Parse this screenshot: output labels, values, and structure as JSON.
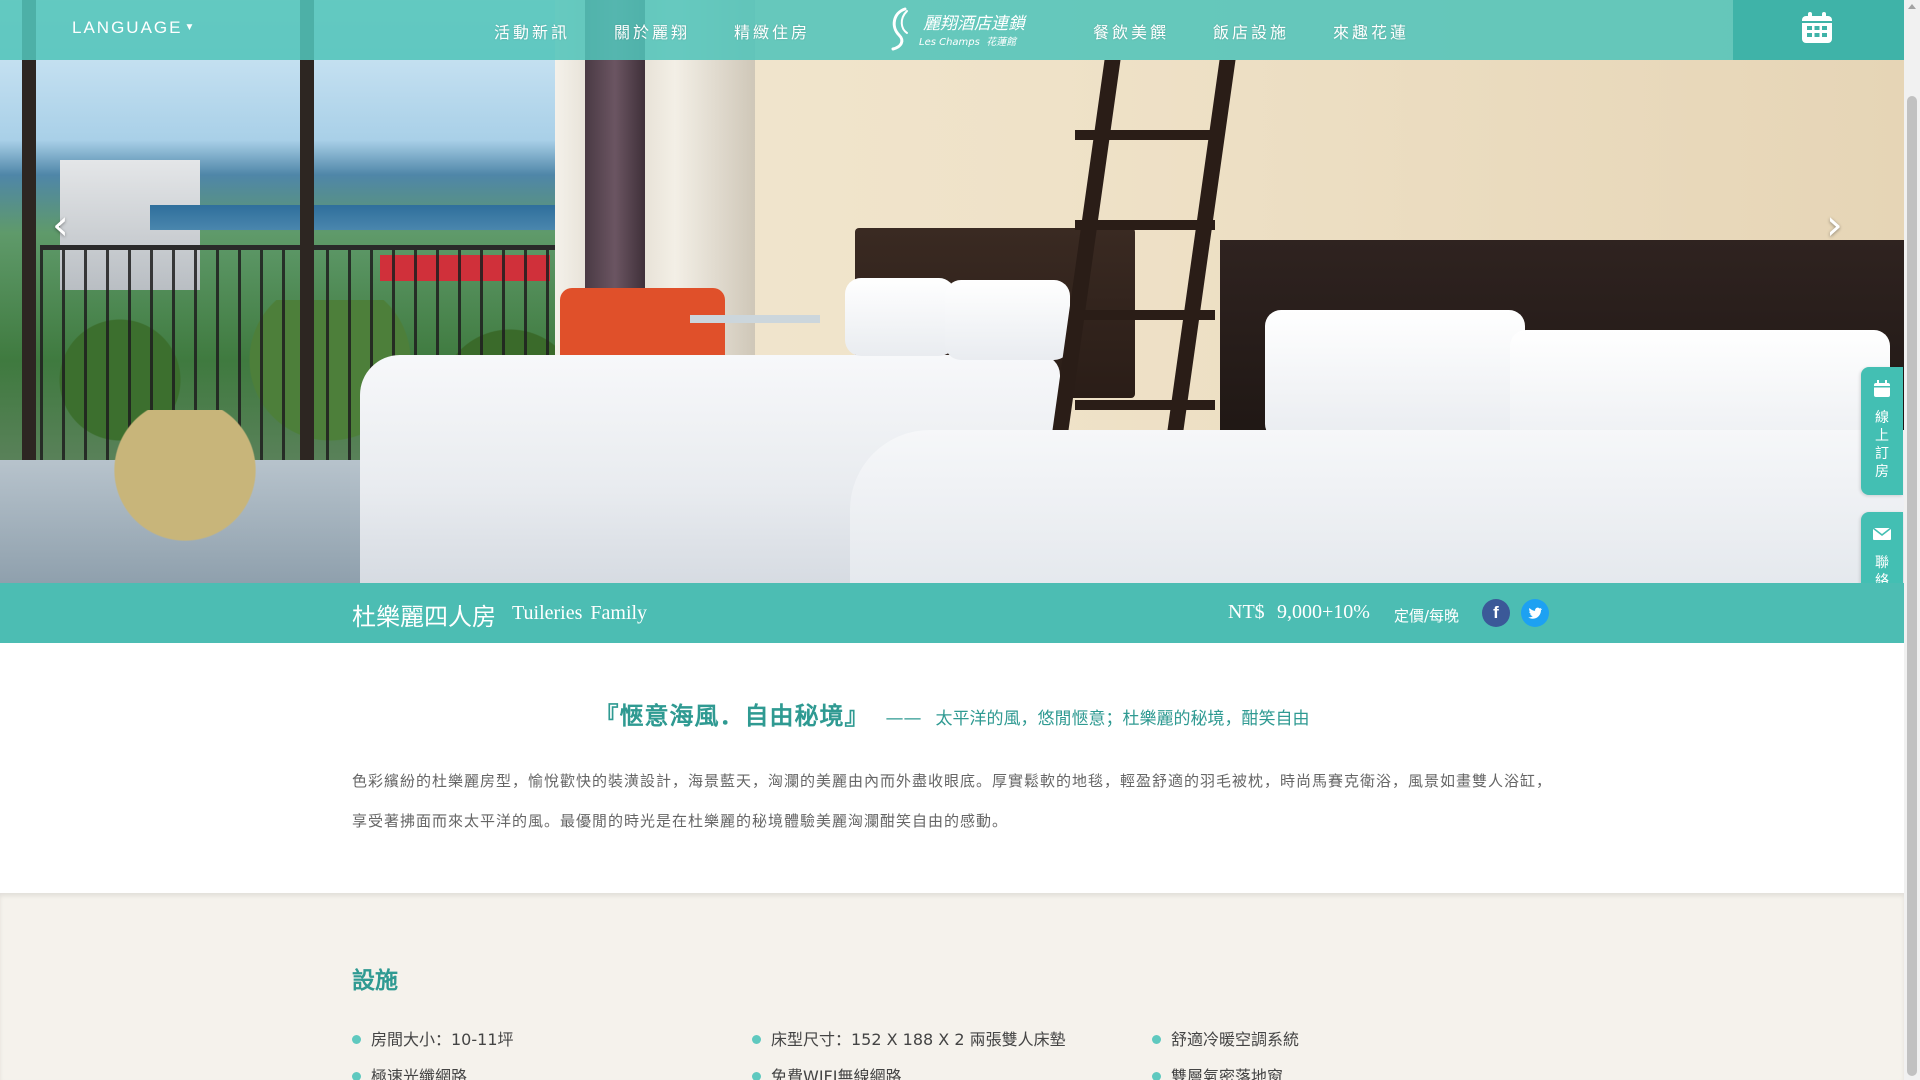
{
  "nav": {
    "language": "LANGUAGE",
    "left_items": [
      "活動新訊",
      "關於麗翔",
      "精緻住房"
    ],
    "right_items": [
      "餐飲美饌",
      "飯店設施",
      "來趣花蓮"
    ],
    "logo_zh": "麗翔酒店連鎖",
    "logo_en": "Les Champs",
    "logo_sub": "花蓮館",
    "calendar_icon": "calendar-icon"
  },
  "side_tabs": [
    {
      "label": "線上訂房",
      "icon": "calendar-icon"
    },
    {
      "label": "聯絡我們",
      "icon": "mail-icon"
    }
  ],
  "room": {
    "name_zh": "杜樂麗四人房",
    "name_en": "Tuileries Family",
    "currency": "NT$",
    "price": "9,000+10%",
    "unit": "定價/每晚"
  },
  "tagline": {
    "title": "『愜意海風．自由秘境』",
    "subtitle": "太平洋的風，悠閒愜意；杜樂麗的秘境，酣笑自由"
  },
  "description": "色彩繽紛的杜樂麗房型，愉悅歡快的裝潢設計，海景藍天，洶瀾的美麗由內而外盡收眼底。厚實鬆軟的地毯，輕盈舒適的羽毛被枕，時尚馬賽克衛浴，風景如畫雙人浴缸，享受著拂面而來太平洋的風。最優閒的時光是在杜樂麗的秘境體驗美麗洶瀾酣笑自由的感動。",
  "facilities": {
    "title": "設施",
    "items": [
      "房間大小：10-11坪",
      "床型尺寸：152 X 188 X 2 兩張雙人床墊",
      "舒適冷暖空調系統",
      "極速光纖網路",
      "免費WIFI無線網路",
      "雙層氣密落地窗"
    ]
  },
  "colors": {
    "teal": "#4cbdb3",
    "teal_dark": "#2f9a92",
    "facebook": "#3b5998",
    "twitter": "#1da1f2"
  }
}
